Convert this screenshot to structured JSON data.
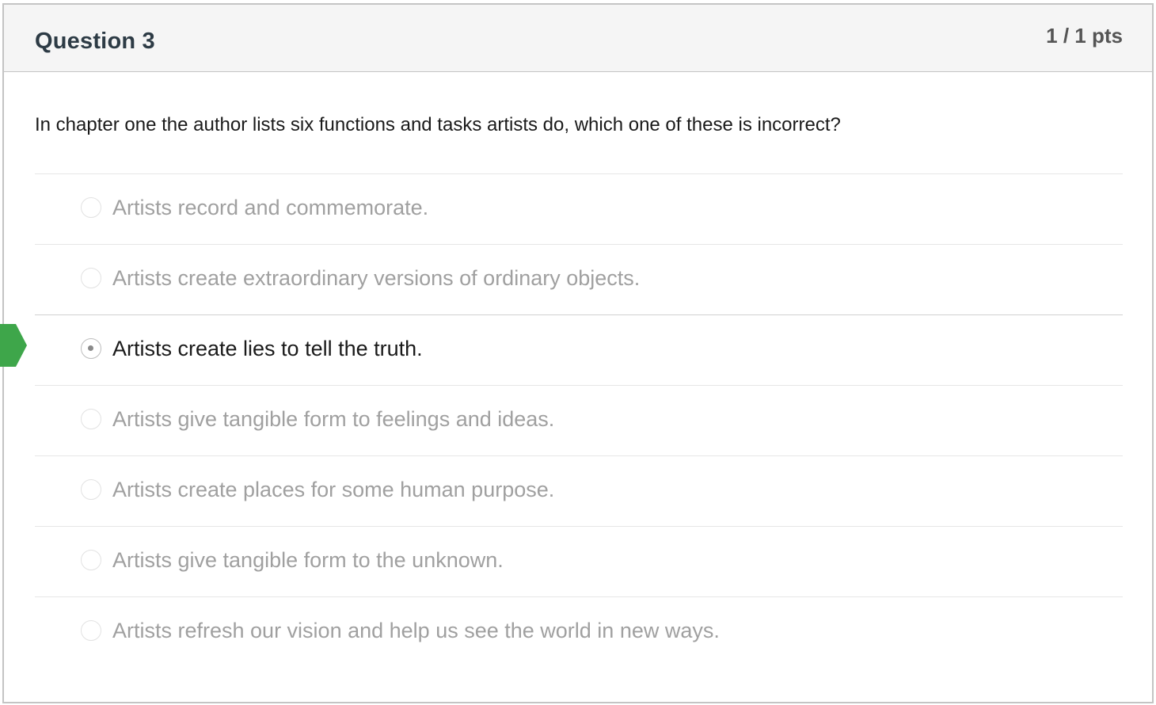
{
  "question": {
    "title": "Question 3",
    "points": "1 / 1 pts",
    "text": "In chapter one the author lists six functions and tasks artists do, which one of these is incorrect?"
  },
  "answers": [
    {
      "label": "Artists record and commemorate.",
      "selected": false
    },
    {
      "label": "Artists create extraordinary versions of ordinary objects.",
      "selected": false
    },
    {
      "label": "Artists create lies to tell the truth.",
      "selected": true
    },
    {
      "label": "Artists give tangible form to feelings and ideas.",
      "selected": false
    },
    {
      "label": "Artists create places for some human purpose.",
      "selected": false
    },
    {
      "label": "Artists give tangible form to the unknown.",
      "selected": false
    },
    {
      "label": "Artists refresh our vision and help us see the world in new ways.",
      "selected": false
    }
  ],
  "colors": {
    "correct_marker": "#3ea64a",
    "header_bg": "#f5f5f5",
    "unselected_text": "#a0a0a0"
  },
  "icons": {
    "correct_marker": "correct-answer-arrow-icon",
    "radio": "radio-button-icon"
  }
}
